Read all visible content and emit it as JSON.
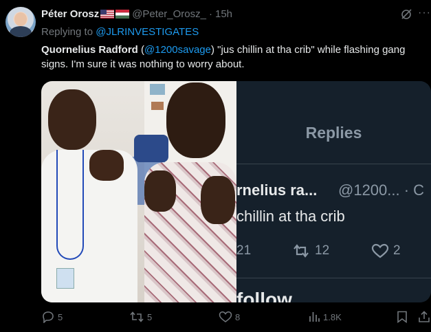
{
  "tweet": {
    "author_name": "Péter Orosz",
    "author_handle": "@Peter_Orosz_",
    "separator": "·",
    "time": "15h",
    "replying_prefix": "Replying to ",
    "replying_to": "@JLRINVESTIGATES",
    "text_name": "Quornelius Radford",
    "text_open": " (",
    "text_handle": "@1200savage",
    "text_rest": ") \"jus chillin at tha crib\" while flashing gang signs. I'm sure it was nothing to worry about."
  },
  "embedded_screenshot": {
    "title": "Replies",
    "reply_name": "rnelius ra...",
    "reply_handle": "@1200... · C",
    "reply_text": "chillin at tha crib",
    "stat_comments": "21",
    "stat_retweets": "12",
    "stat_likes": "2",
    "follow_text": "follow"
  },
  "actions": {
    "replies": "5",
    "reposts": "5",
    "likes": "8",
    "views": "1.8K"
  },
  "icons": {
    "grok": "grok-icon",
    "more": "more-icon",
    "reply": "reply-icon",
    "repost": "repost-icon",
    "like": "like-icon",
    "views": "views-icon",
    "bookmark": "bookmark-icon",
    "share": "share-icon"
  },
  "colors": {
    "background": "#000000",
    "text": "#e7e9ea",
    "muted": "#71767b",
    "link": "#1d9bf0"
  }
}
